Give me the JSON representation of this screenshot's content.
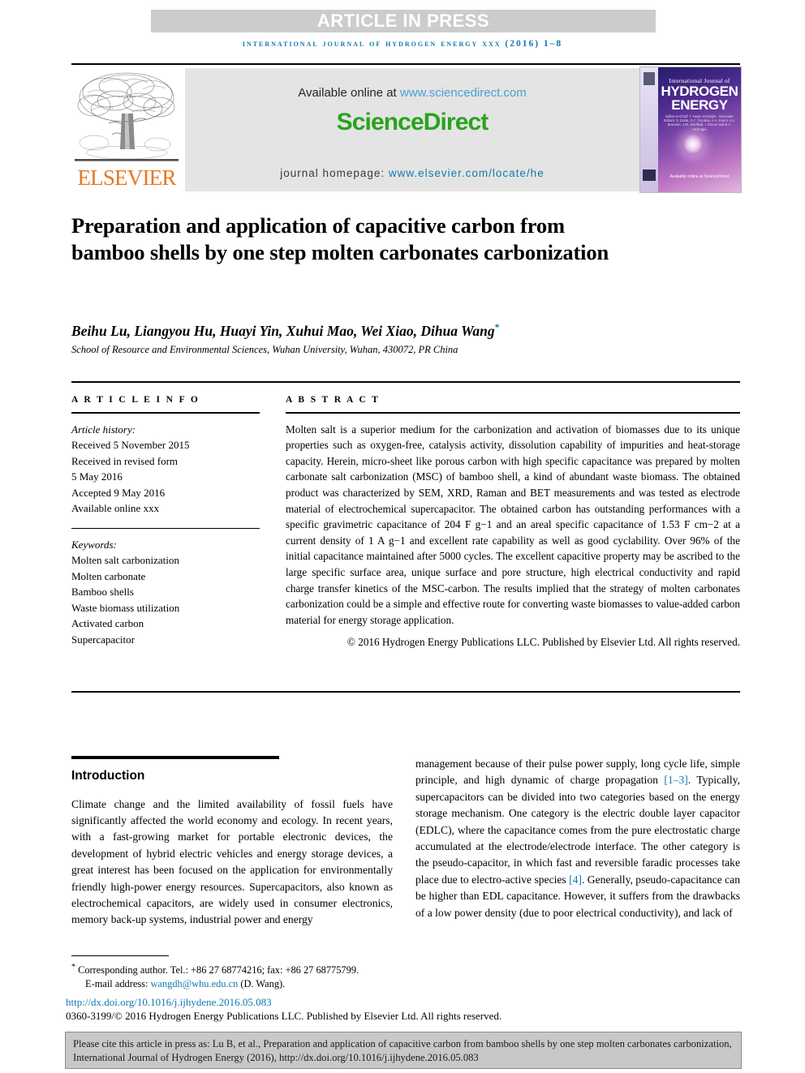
{
  "banner": {
    "article_in_press": "ARTICLE IN PRESS",
    "running_head": "international journal of hydrogen energy xxx (2016) 1–8"
  },
  "masthead": {
    "elsevier_wordmark": "ELSEVIER",
    "available_online_prefix": "Available online at ",
    "sciencedirect_url": "www.sciencedirect.com",
    "sciencedirect_logo": "ScienceDirect",
    "homepage_prefix": "journal homepage: ",
    "homepage_url": "www.elsevier.com/locate/he",
    "cover": {
      "line_top": "International Journal of",
      "line_1": "HYDROGEN",
      "line_2": "ENERGY",
      "editors": "Editor-in-Chief: T. Nejat Veziroğlu  ·  Associate Editors: S. Dutta, D.C. Dunikov, A.A. Evers, A.L. Brandao, J.W. Sheffield, I. Dincer and E.A. Veziroglu",
      "sciencedirect_mark": "Available online at ScienceDirect"
    }
  },
  "article": {
    "title": "Preparation and application of capacitive carbon from bamboo shells by one step molten carbonates carbonization",
    "authors": "Beihu Lu, Liangyou Hu, Huayi Yin, Xuhui Mao, Wei Xiao, Dihua Wang",
    "corresponding_marker": "*",
    "affiliation": "School of Resource and Environmental Sciences, Wuhan University, Wuhan, 430072, PR China"
  },
  "article_info": {
    "heading": "A R T I C L E   I N F O",
    "history_label": "Article history:",
    "history": [
      "Received 5 November 2015",
      "Received in revised form",
      "5 May 2016",
      "Accepted 9 May 2016",
      "Available online xxx"
    ],
    "keywords_label": "Keywords:",
    "keywords": [
      "Molten salt carbonization",
      "Molten carbonate",
      "Bamboo shells",
      "Waste biomass utilization",
      "Activated carbon",
      "Supercapacitor"
    ]
  },
  "abstract": {
    "heading": "A B S T R A C T",
    "text": "Molten salt is a superior medium for the carbonization and activation of biomasses due to its unique properties such as oxygen-free, catalysis activity, dissolution capability of impurities and heat-storage capacity. Herein, micro-sheet like porous carbon with high specific capacitance was prepared by molten carbonate salt carbonization (MSC) of bamboo shell, a kind of abundant waste biomass. The obtained product was characterized by SEM, XRD, Raman and BET measurements and was tested as electrode material of electrochemical supercapacitor. The obtained carbon has outstanding performances with a specific gravimetric capacitance of 204 F g−1 and an areal specific capacitance of 1.53 F cm−2 at a current density of 1 A g−1 and excellent rate capability as well as good cyclability. Over 96% of the initial capacitance maintained after 5000 cycles. The excellent capacitive property may be ascribed to the large specific surface area, unique surface and pore structure, high electrical conductivity and rapid charge transfer kinetics of the MSC-carbon. The results implied that the strategy of molten carbonates carbonization could be a simple and effective route for converting waste biomasses to value-added carbon material for energy storage application.",
    "copyright": "© 2016 Hydrogen Energy Publications LLC. Published by Elsevier Ltd. All rights reserved."
  },
  "body": {
    "section_title": "Introduction",
    "left_paragraph": "Climate change and the limited availability of fossil fuels have significantly affected the world economy and ecology. In recent years, with a fast-growing market for portable electronic devices, the development of hybrid electric vehicles and energy storage devices, a great interest has been focused on the application for environmentally friendly high-power energy resources. Supercapacitors, also known as electrochemical capacitors, are widely used in consumer electronics, memory back-up systems, industrial power and energy",
    "right_part_1": "management because of their pulse power supply, long cycle life, simple principle, and high dynamic of charge propagation ",
    "right_cite_1": "[1–3]",
    "right_part_2": ". Typically, supercapacitors can be divided into two categories based on the energy storage mechanism. One category is the electric double layer capacitor (EDLC), where the capacitance comes from the pure electrostatic charge accumulated at the electrode/electrode interface. The other category is the pseudo-capacitor, in which fast and reversible faradic processes take place due to electro-active species ",
    "right_cite_2": "[4]",
    "right_part_3": ". Generally, pseudo-capacitance can be higher than EDL capacitance. However, it suffers from the drawbacks of a low power density (due to poor electrical conductivity), and lack of"
  },
  "footer": {
    "corresponding_star": "*",
    "corresponding_text": " Corresponding author. Tel.: +86 27 68774216; fax: +86 27 68775799.",
    "email_label": "E-mail address: ",
    "email": "wangdh@whu.edu.cn",
    "email_suffix": " (D. Wang).",
    "doi": "http://dx.doi.org/10.1016/j.ijhydene.2016.05.083",
    "issn": "0360-3199/© 2016 Hydrogen Energy Publications LLC. Published by Elsevier Ltd. All rights reserved.",
    "cite_box": "Please cite this article in press as: Lu B, et al., Preparation and application of capacitive carbon from bamboo shells by one step molten carbonates carbonization, International Journal of Hydrogen Energy (2016), http://dx.doi.org/10.1016/j.ijhydene.2016.05.083"
  },
  "colors": {
    "banner_gray": "#cccccc",
    "journal_blue": "#1379b0",
    "sciencedirect_green": "#2aa31f",
    "elsevier_orange": "#e87722",
    "link_blue": "#4b9fd5",
    "cite_box_gray": "#c8c8c8"
  }
}
